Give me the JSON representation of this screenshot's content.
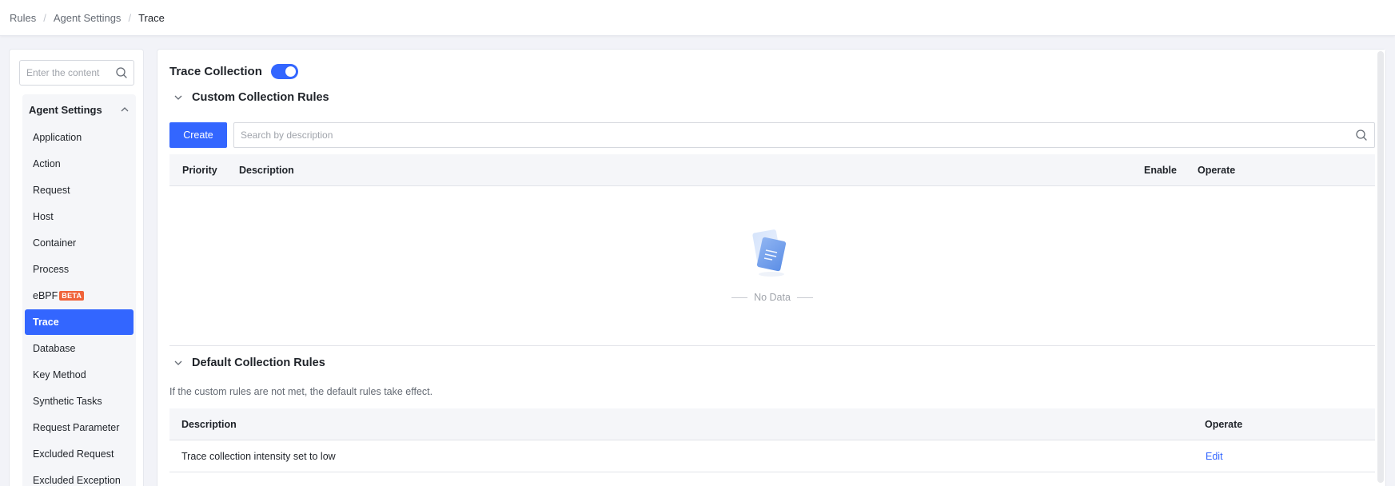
{
  "breadcrumb": [
    "Rules",
    "Agent Settings",
    "Trace"
  ],
  "sidebar": {
    "search_placeholder": "Enter the content",
    "group_title": "Agent Settings",
    "items": [
      {
        "label": "Application"
      },
      {
        "label": "Action"
      },
      {
        "label": "Request"
      },
      {
        "label": "Host"
      },
      {
        "label": "Container"
      },
      {
        "label": "Process"
      },
      {
        "label": "eBPF",
        "badge": "BETA"
      },
      {
        "label": "Trace",
        "active": true
      },
      {
        "label": "Database"
      },
      {
        "label": "Key Method"
      },
      {
        "label": "Synthetic Tasks"
      },
      {
        "label": "Request Parameter"
      },
      {
        "label": "Excluded Request"
      },
      {
        "label": "Excluded Exception"
      }
    ]
  },
  "main": {
    "trace_collection": {
      "title": "Trace Collection",
      "enabled": true
    },
    "custom_rules": {
      "title": "Custom Collection Rules",
      "create_label": "Create",
      "search_placeholder": "Search by description",
      "columns": [
        "Priority",
        "Description",
        "Enable",
        "Operate"
      ],
      "empty_text": "No Data"
    },
    "default_rules": {
      "title": "Default Collection Rules",
      "note": "If the custom rules are not met, the default rules take effect.",
      "columns": [
        "Description",
        "Operate"
      ],
      "rows": [
        {
          "description": "Trace collection intensity set to low",
          "action": "Edit"
        }
      ]
    }
  },
  "colors": {
    "accent": "#3366ff",
    "beta": "#f0633a",
    "background": "#f2f3f8"
  }
}
